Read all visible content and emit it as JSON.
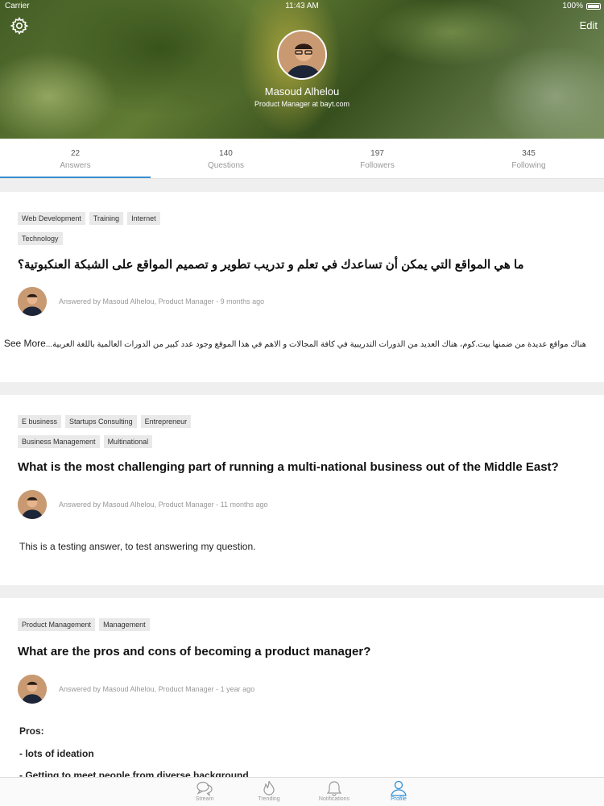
{
  "status_bar": {
    "carrier": "Carrier",
    "time": "11:43 AM",
    "battery": "100%"
  },
  "header": {
    "edit_label": "Edit",
    "name": "Masoud Alhelou",
    "title": "Product Manager at bayt.com"
  },
  "stats": [
    {
      "value": "22",
      "label": "Answers"
    },
    {
      "value": "140",
      "label": "Questions"
    },
    {
      "value": "197",
      "label": "Followers"
    },
    {
      "value": "345",
      "label": "Following"
    }
  ],
  "cards": [
    {
      "tags": [
        "Web Development",
        "Training",
        "Internet",
        "Technology"
      ],
      "question": "ما هي المواقع التي يمكن أن تساعدك في تعلم و تدريب تطوير و تصميم المواقع على الشبكة العنكبوتية؟",
      "byline": "Answered by Masoud Alhelou, Product Manager - 9 months ago",
      "answer": "هناك مواقع عديدة من ضمنها بيت.كوم، هناك العديد من الدورات التدريبية في كافة المجالات و الاهم في هذا الموقع وجود عدد كبير من الدورات العالمية باللغة العربية...",
      "see_more": "See More"
    },
    {
      "tags": [
        "E business",
        "Startups Consulting",
        "Entrepreneur",
        "Business Management",
        "Multinational"
      ],
      "question": "What is the most challenging part of running a multi-national business out of the Middle East?",
      "byline": "Answered by Masoud Alhelou, Product Manager - 11 months ago",
      "answer": "This is a testing answer, to test answering my question."
    },
    {
      "tags": [
        "Product Management",
        "Management"
      ],
      "question": "What are the pros and cons of becoming a product manager?",
      "byline": "Answered by Masoud Alhelou, Product Manager - 1 year ago",
      "answer_lines": [
        "Pros:",
        "- lots of ideation",
        "- Getting to meet people from diverse background"
      ]
    }
  ],
  "tabbar": [
    {
      "label": "Stream",
      "icon": "chat-bubbles-icon"
    },
    {
      "label": "Trending",
      "icon": "flame-icon"
    },
    {
      "label": "Notifications",
      "icon": "bell-icon"
    },
    {
      "label": "Profile",
      "icon": "person-icon",
      "active": true
    }
  ],
  "colors": {
    "accent": "#2d8ed8",
    "tag_bg": "#e9e9e9",
    "background": "#efefef"
  }
}
